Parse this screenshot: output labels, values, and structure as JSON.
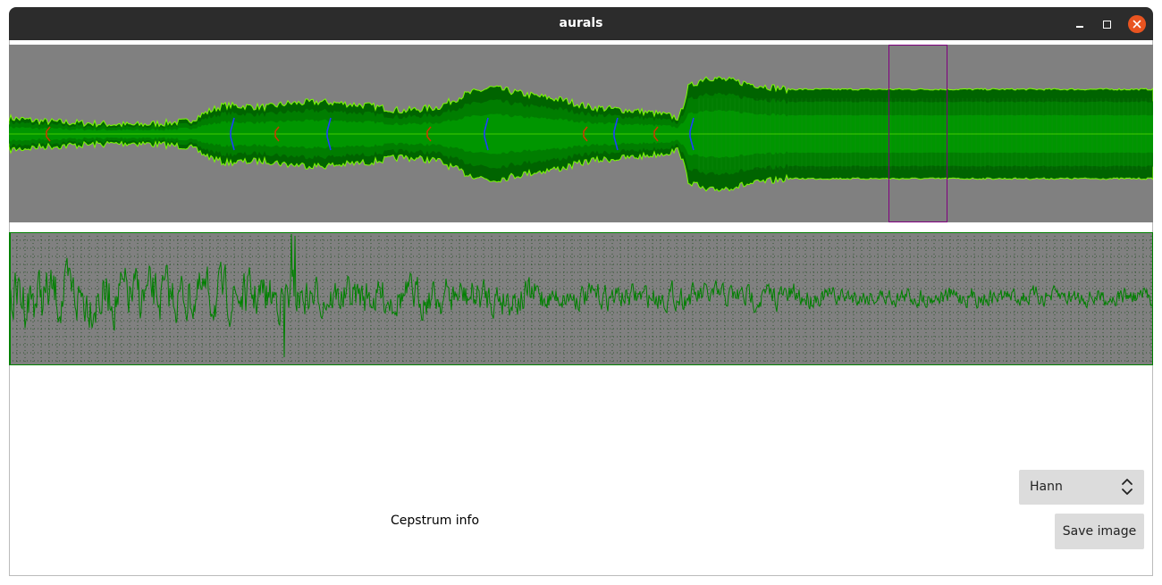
{
  "window": {
    "title": "aurals"
  },
  "cepstrum": {
    "info_label": "Cepstrum info"
  },
  "window_function": {
    "selected": "Hann"
  },
  "actions": {
    "save_label": "Save image"
  },
  "colors": {
    "panel_bg": "#808080",
    "trace": "#008000",
    "fill_dark": "#006400",
    "fill_mid": "#007d00",
    "fill_light": "#009600",
    "edge": "#7cfc00",
    "marker_blue": "#1f3fff",
    "marker_red": "#c83c00",
    "selection": "#800080",
    "grid_dot": "#104010",
    "close_button": "#e95420"
  },
  "icons": {
    "minimize": "minimize-icon",
    "maximize": "maximize-icon",
    "close": "close-icon",
    "dropdown": "up-down-chevron-icon"
  }
}
